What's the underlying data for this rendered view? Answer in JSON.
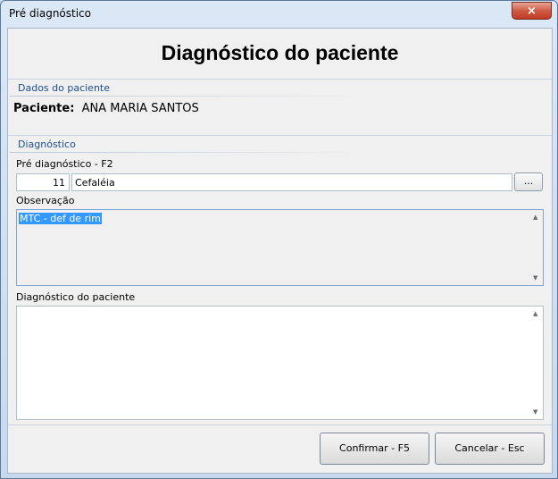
{
  "window": {
    "title": "Pré diagnóstico",
    "close_symbol": "×"
  },
  "header": {
    "title": "Diagnóstico do paciente"
  },
  "patient_group": {
    "label": "Dados do paciente",
    "patient_label": "Paciente:",
    "patient_name": "ANA MARIA SANTOS"
  },
  "diagnosis_group": {
    "label": "Diagnóstico",
    "pre_label": "Pré diagnóstico - F2",
    "code": "11",
    "description": "Cefaléia",
    "browse_label": "...",
    "obs_label": "Observação",
    "obs_value": "MTC - def de rim",
    "diag_label": "Diagnóstico do paciente",
    "diag_value": ""
  },
  "buttons": {
    "confirm": "Confirmar - F5",
    "cancel": "Cancelar - Esc"
  }
}
